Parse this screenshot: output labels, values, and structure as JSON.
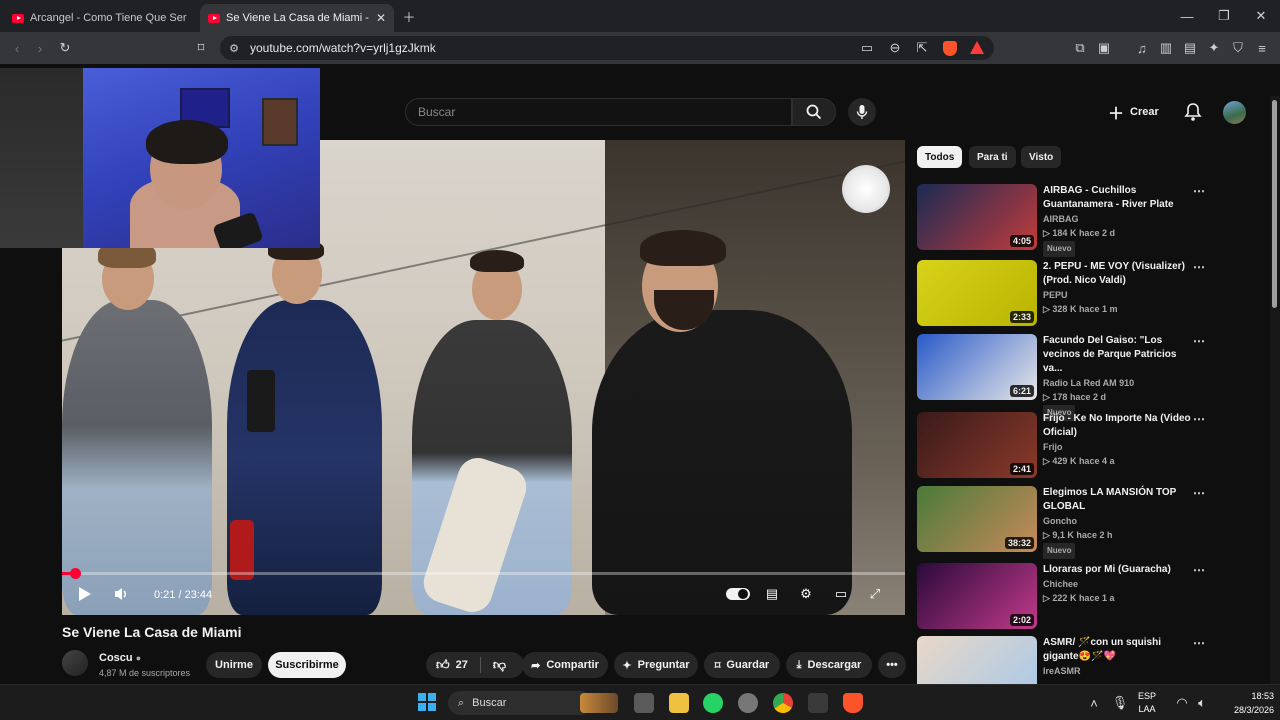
{
  "browser": {
    "tabs": [
      {
        "title": "Arcangel - Como Tiene Que Ser - Yo",
        "active": false
      },
      {
        "title": "Se Viene La Casa de Miami - You",
        "active": true
      }
    ],
    "new_tab_icon": "plus-icon",
    "url": "youtube.com/watch?v=yrlj1gzJkmk",
    "window_controls": [
      "minimize",
      "maximize",
      "close"
    ]
  },
  "youtube": {
    "search": {
      "placeholder": "Buscar"
    },
    "create_label": "Crear",
    "video": {
      "title": "Se Viene La Casa de Miami",
      "time": "0:21 / 23:44",
      "progress": 0.015
    },
    "channel": {
      "name": "Coscu",
      "subscribers": "4,87 M de suscriptores",
      "join_label": "Unirme",
      "subscribe_label": "Suscribirme"
    },
    "actions": {
      "likes": "27",
      "share": "Compartir",
      "ask": "Preguntar",
      "save": "Guardar",
      "download": "Descargar"
    },
    "chips": [
      "Todos",
      "Para ti",
      "Visto"
    ],
    "recommendations": [
      {
        "title": "AIRBAG - Cuchillos Guantanamera - River Plate",
        "channel": "AIRBAG",
        "meta": "▷ 184 K  hace 2 d",
        "badge": "Nuevo",
        "duration": "4:05",
        "colors": [
          "#1b2a55",
          "#c23b3b"
        ]
      },
      {
        "title": "2. PEPU - ME VOY (Visualizer) (Prod. Nico Valdi)",
        "channel": "PEPU",
        "meta": "▷ 328 K  hace 1 m",
        "badge": "",
        "duration": "2:33",
        "colors": [
          "#d8d21a",
          "#b8b400"
        ]
      },
      {
        "title": "Facundo Del Gaiso: \"Los vecinos de Parque Patricios va...",
        "channel": "Radio La Red AM 910",
        "meta": "▷ 178  hace 2 d",
        "badge": "Nuevo",
        "duration": "6:21",
        "colors": [
          "#2a5ac8",
          "#e8e8e8"
        ]
      },
      {
        "title": "Frijo - Ke No Importe Na (Video Oficial)",
        "channel": "Frijo",
        "meta": "▷ 429 K  hace 4 a",
        "badge": "",
        "duration": "2:41",
        "colors": [
          "#3a1a1a",
          "#8a3a2a"
        ]
      },
      {
        "title": "Elegimos LA MANSIÓN TOP GLOBAL",
        "channel": "Goncho",
        "meta": "▷ 9,1 K  hace 2 h",
        "badge": "Nuevo",
        "duration": "38:32",
        "colors": [
          "#4a7a3a",
          "#c88a5a"
        ]
      },
      {
        "title": "Lloraras por Mi (Guaracha)",
        "channel": "Chichee",
        "meta": "▷ 222 K  hace 1 a",
        "badge": "",
        "duration": "2:02",
        "colors": [
          "#2a0a3a",
          "#c23a8a"
        ]
      },
      {
        "title": "ASMR/ 🪄con un squishi gigante😍🪄💖",
        "channel": "IreASMR",
        "meta": "",
        "badge": "",
        "duration": "",
        "colors": [
          "#e8d8c8",
          "#a8c8e8"
        ]
      }
    ]
  },
  "taskbar": {
    "search_placeholder": "Buscar",
    "lang": "ESP",
    "lang2": "LAA",
    "time": "18:53",
    "date": "28/3/2026"
  }
}
